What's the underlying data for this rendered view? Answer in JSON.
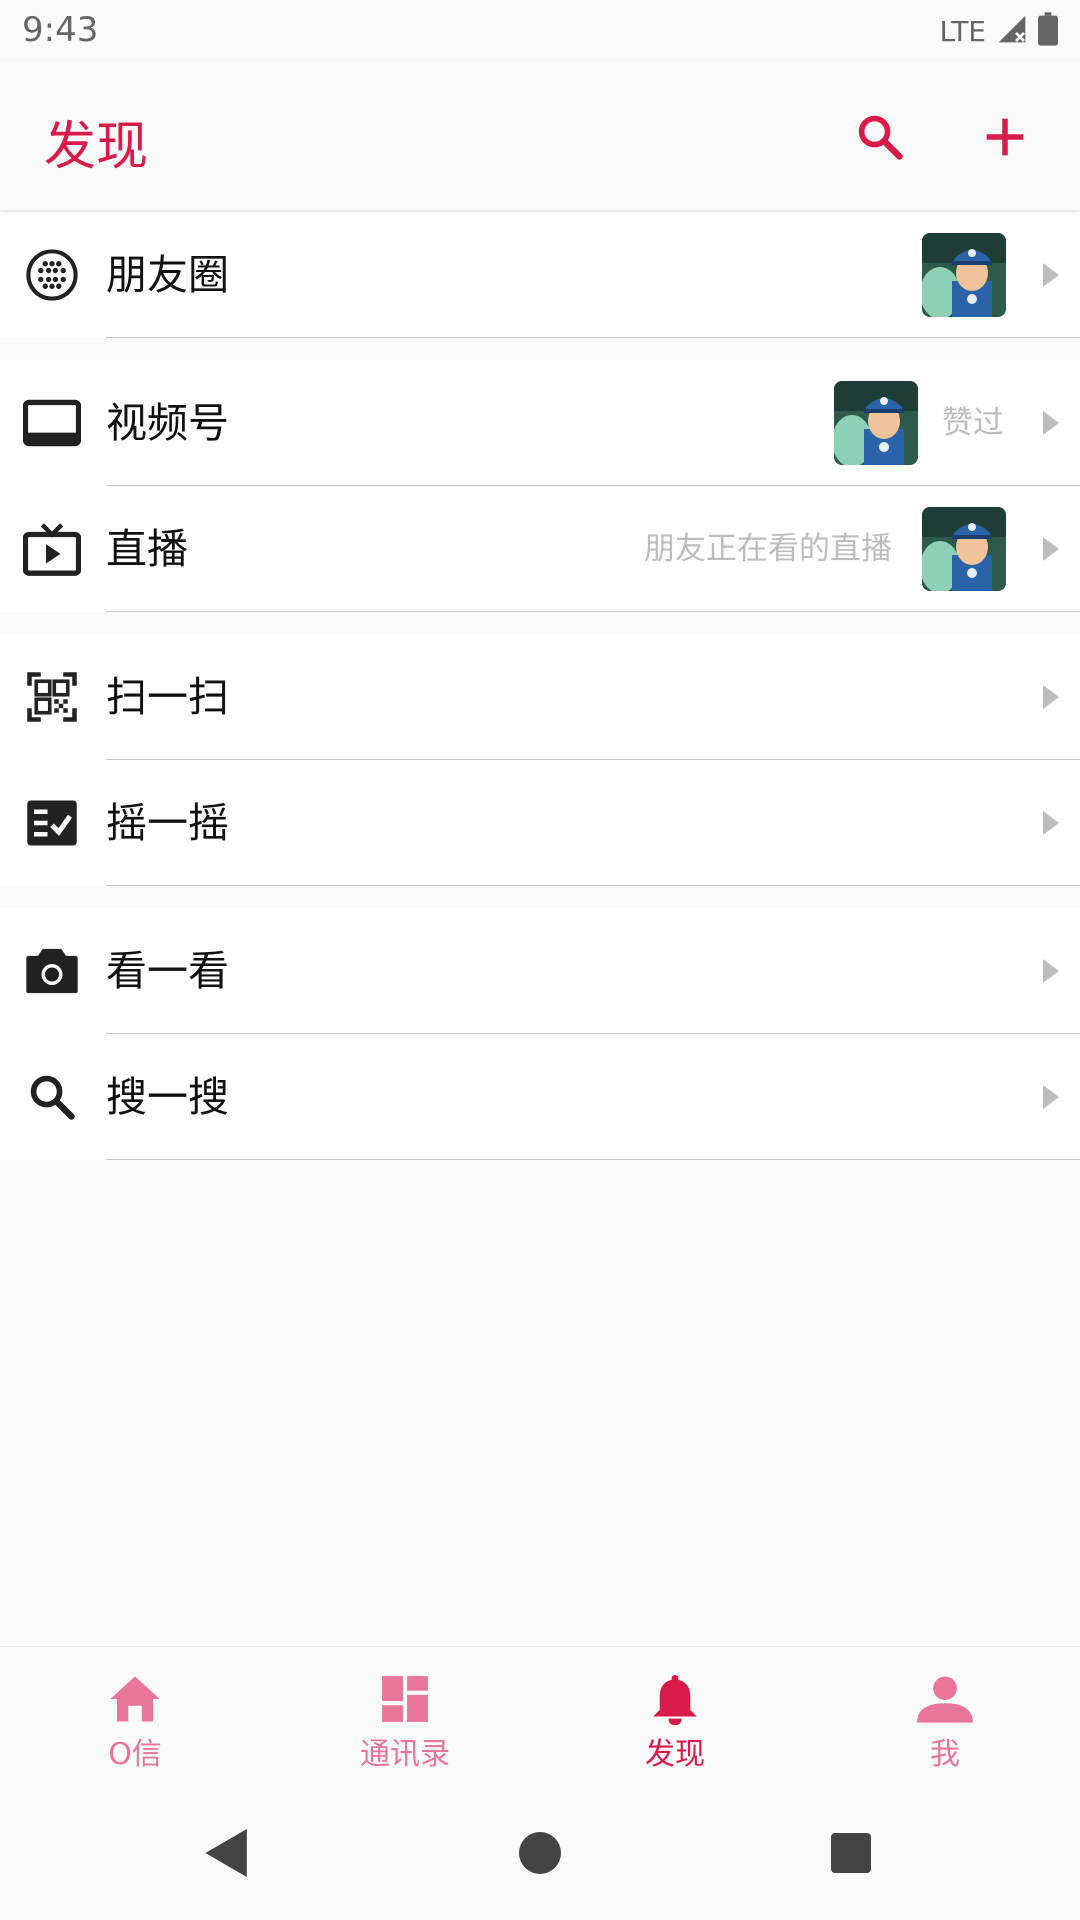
{
  "status_bar": {
    "time": "9:43",
    "network": "LTE"
  },
  "app_bar": {
    "title": "发现",
    "accent": "#d81b4a"
  },
  "sections": [
    {
      "items": [
        {
          "label": "朋友圈",
          "icon": "moments-icon",
          "subtitle": "",
          "has_thumb": true
        }
      ]
    },
    {
      "items": [
        {
          "label": "视频号",
          "icon": "video-channel-icon",
          "subtitle": "赞过",
          "has_thumb": true
        },
        {
          "label": "直播",
          "icon": "live-tv-icon",
          "subtitle": "朋友正在看的直播",
          "has_thumb": true
        }
      ]
    },
    {
      "items": [
        {
          "label": "扫一扫",
          "icon": "qr-scan-icon",
          "subtitle": "",
          "has_thumb": false
        },
        {
          "label": "摇一摇",
          "icon": "checklist-icon",
          "subtitle": "",
          "has_thumb": false
        }
      ]
    },
    {
      "items": [
        {
          "label": "看一看",
          "icon": "camera-icon",
          "subtitle": "",
          "has_thumb": false
        },
        {
          "label": "搜一搜",
          "icon": "search-icon",
          "subtitle": "",
          "has_thumb": false
        }
      ]
    }
  ],
  "bottom_nav": {
    "items": [
      {
        "label": "O信",
        "icon": "home-icon",
        "active": false
      },
      {
        "label": "通讯录",
        "icon": "dashboard-icon",
        "active": false
      },
      {
        "label": "发现",
        "icon": "bell-icon",
        "active": true
      },
      {
        "label": "我",
        "icon": "person-icon",
        "active": false
      }
    ],
    "active_color": "#d81b4a",
    "inactive_color": "#e8769a"
  }
}
